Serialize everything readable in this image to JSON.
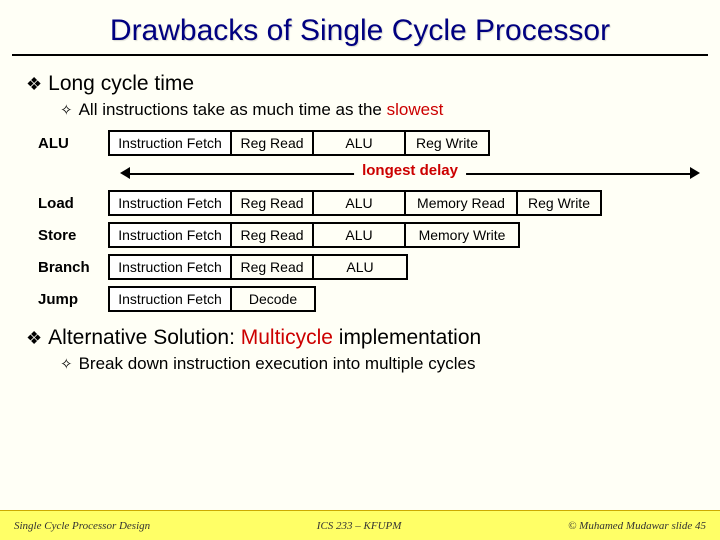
{
  "title": "Drawbacks of Single Cycle Processor",
  "bullets": {
    "b1": "Long cycle time",
    "b1a_pre": "All instructions take as much time as the ",
    "b1a_em": "slowest",
    "alt_pre": "Alternative Solution: ",
    "alt_em": "Multicycle",
    "alt_post": " implementation",
    "alt_a": "Break down instruction execution into multiple cycles"
  },
  "delay_label": "longest delay",
  "rows": {
    "alu": {
      "label": "ALU",
      "s": [
        "Instruction Fetch",
        "Reg Read",
        "ALU",
        "Reg Write"
      ],
      "w": [
        "w-if",
        "w-rr",
        "w-alu",
        "w-rw"
      ]
    },
    "load": {
      "label": "Load",
      "s": [
        "Instruction Fetch",
        "Reg Read",
        "ALU",
        "Memory Read",
        "Reg Write"
      ],
      "w": [
        "w-if",
        "w-rr",
        "w-alu",
        "w-mr",
        "w-rw"
      ]
    },
    "store": {
      "label": "Store",
      "s": [
        "Instruction Fetch",
        "Reg Read",
        "ALU",
        "Memory Write"
      ],
      "w": [
        "w-if",
        "w-rr",
        "w-alu",
        "w-mw"
      ]
    },
    "branch": {
      "label": "Branch",
      "s": [
        "Instruction Fetch",
        "Reg Read",
        "ALU"
      ],
      "w": [
        "w-if",
        "w-rr",
        "w-alu"
      ]
    },
    "jump": {
      "label": "Jump",
      "s": [
        "Instruction Fetch",
        "Decode"
      ],
      "w": [
        "w-if",
        "w-dec"
      ]
    }
  },
  "footer": {
    "left": "Single Cycle Processor Design",
    "center": "ICS 233 – KFUPM",
    "right": "© Muhamed Mudawar   slide 45"
  }
}
